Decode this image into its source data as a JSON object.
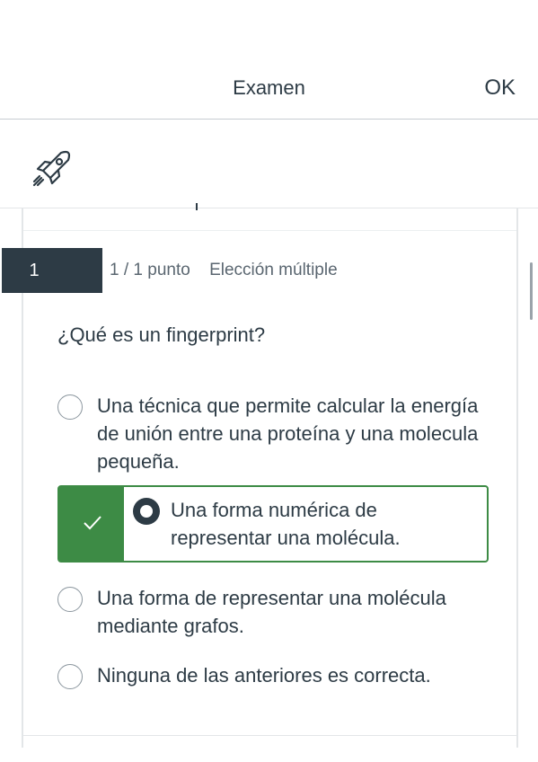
{
  "header": {
    "title": "Examen",
    "ok_label": "OK"
  },
  "toolbar": {
    "icon": "rocket-icon"
  },
  "question": {
    "number": "1",
    "points": "1 / 1 punto",
    "type": "Elección múltiple",
    "text": "¿Qué es un fingerprint?",
    "answers": [
      {
        "label": "Una técnica que permite calcular la energía de unión entre una proteína y una molecula pequeña.",
        "selected": false,
        "correct": false
      },
      {
        "label": "Una forma numérica de representar una molécula.",
        "selected": true,
        "correct": true
      },
      {
        "label": "Una forma de representar una molécula mediante grafos.",
        "selected": false,
        "correct": false
      },
      {
        "label": "Ninguna de las anteriores es correcta.",
        "selected": false,
        "correct": false
      }
    ]
  },
  "colors": {
    "correct": "#3d8b45",
    "dark": "#2d3b45"
  }
}
